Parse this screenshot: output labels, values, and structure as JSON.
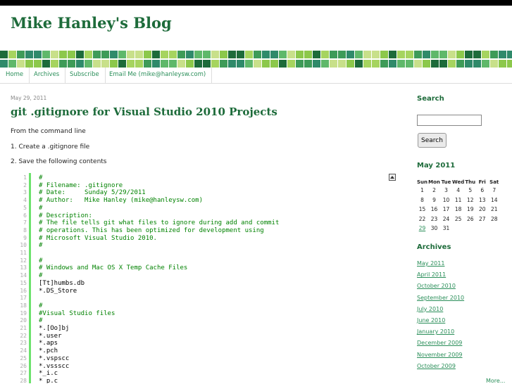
{
  "header": {
    "blog_title": "Mike Hanley's Blog"
  },
  "nav": {
    "items": [
      {
        "label": "Home"
      },
      {
        "label": "Archives"
      },
      {
        "label": "Subscribe"
      },
      {
        "label": "Email Me (mike@hanleysw.com)"
      }
    ]
  },
  "post": {
    "date": "May 29, 2011",
    "title": "git .gitignore for Visual Studio 2010 Projects",
    "paragraphs": [
      "From the command line",
      "1. Create a .gitignore file",
      "2. Save the following contents"
    ],
    "code_lines": [
      {
        "n": "1",
        "text": "#"
      },
      {
        "n": "2",
        "text": "# Filename: .gitignore"
      },
      {
        "n": "3",
        "text": "# Date:     Sunday 5/29/2011"
      },
      {
        "n": "4",
        "text": "# Author:   Mike Hanley (mike@hanleysw.com)"
      },
      {
        "n": "5",
        "text": "#"
      },
      {
        "n": "6",
        "text": "# Description:"
      },
      {
        "n": "7",
        "text": "# The file tells git what files to ignore during add and commit"
      },
      {
        "n": "8",
        "text": "# operations. This has been optimized for development using"
      },
      {
        "n": "9",
        "text": "# Microsoft Visual Studio 2010."
      },
      {
        "n": "10",
        "text": "#"
      },
      {
        "n": "11",
        "text": ""
      },
      {
        "n": "12",
        "text": "#"
      },
      {
        "n": "13",
        "text": "# Windows and Mac OS X Temp Cache Files"
      },
      {
        "n": "14",
        "text": "#"
      },
      {
        "n": "15",
        "text": "[Tt]humbs.db"
      },
      {
        "n": "16",
        "text": "*.DS_Store"
      },
      {
        "n": "17",
        "text": ""
      },
      {
        "n": "18",
        "text": "#"
      },
      {
        "n": "19",
        "text": "#Visual Studio files"
      },
      {
        "n": "20",
        "text": "#"
      },
      {
        "n": "21",
        "text": "*.[Oo]bj"
      },
      {
        "n": "22",
        "text": "*.user"
      },
      {
        "n": "23",
        "text": "*.aps"
      },
      {
        "n": "24",
        "text": "*.pch"
      },
      {
        "n": "25",
        "text": "*.vspscc"
      },
      {
        "n": "26",
        "text": "*.vssscc"
      },
      {
        "n": "27",
        "text": "*_i.c"
      },
      {
        "n": "28",
        "text": "*_p.c"
      }
    ]
  },
  "sidebar": {
    "search_heading": "Search",
    "search_button": "Search",
    "calendar_heading": "May 2011",
    "calendar": {
      "days": [
        "Sun",
        "Mon",
        "Tue",
        "Wed",
        "Thu",
        "Fri",
        "Sat"
      ],
      "weeks": [
        [
          "1",
          "2",
          "3",
          "4",
          "5",
          "6",
          "7"
        ],
        [
          "8",
          "9",
          "10",
          "11",
          "12",
          "13",
          "14"
        ],
        [
          "15",
          "16",
          "17",
          "18",
          "19",
          "20",
          "21"
        ],
        [
          "22",
          "23",
          "24",
          "25",
          "26",
          "27",
          "28"
        ],
        [
          "29",
          "30",
          "31",
          "",
          "",
          "",
          ""
        ]
      ],
      "linked_day": "29"
    },
    "archives_heading": "Archives",
    "archives": [
      "May 2011",
      "April 2011",
      "October 2010",
      "September 2010",
      "July 2010",
      "June 2010",
      "January 2010",
      "December 2009",
      "November 2009",
      "October 2009"
    ],
    "more": "More..."
  },
  "colors": {
    "title_green": "#1d6b3a",
    "link_green": "#2b8f5a",
    "code_comment_green": "#008200",
    "gutter_green": "#6ce26c",
    "mosaic": [
      "#1d6b3a",
      "#3e9b58",
      "#5fb86a",
      "#8cc84b",
      "#a6d45f",
      "#2f8a6a",
      "#c8e08a"
    ]
  }
}
